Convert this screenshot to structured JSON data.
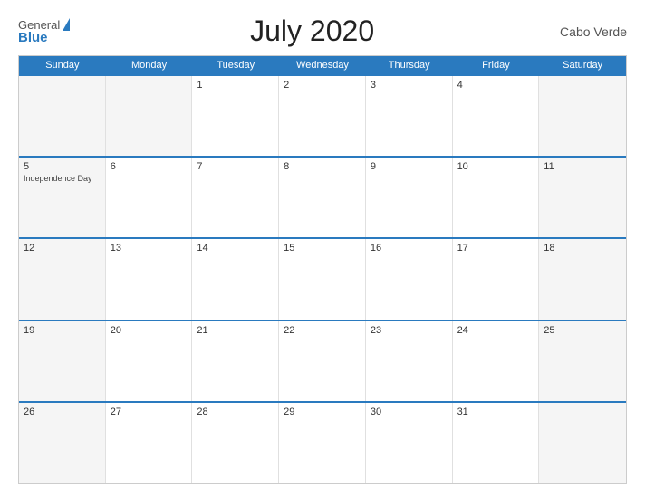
{
  "header": {
    "title": "July 2020",
    "country": "Cabo Verde",
    "logo_general": "General",
    "logo_blue": "Blue"
  },
  "calendar": {
    "days_of_week": [
      "Sunday",
      "Monday",
      "Tuesday",
      "Wednesday",
      "Thursday",
      "Friday",
      "Saturday"
    ],
    "weeks": [
      [
        {
          "day": "",
          "event": "",
          "empty": true
        },
        {
          "day": "",
          "event": "",
          "empty": true
        },
        {
          "day": "1",
          "event": "",
          "empty": false
        },
        {
          "day": "2",
          "event": "",
          "empty": false
        },
        {
          "day": "3",
          "event": "",
          "empty": false
        },
        {
          "day": "4",
          "event": "",
          "empty": false
        },
        {
          "day": "",
          "event": "",
          "empty": true
        }
      ],
      [
        {
          "day": "5",
          "event": "Independence Day",
          "empty": false
        },
        {
          "day": "6",
          "event": "",
          "empty": false
        },
        {
          "day": "7",
          "event": "",
          "empty": false
        },
        {
          "day": "8",
          "event": "",
          "empty": false
        },
        {
          "day": "9",
          "event": "",
          "empty": false
        },
        {
          "day": "10",
          "event": "",
          "empty": false
        },
        {
          "day": "11",
          "event": "",
          "empty": false
        }
      ],
      [
        {
          "day": "12",
          "event": "",
          "empty": false
        },
        {
          "day": "13",
          "event": "",
          "empty": false
        },
        {
          "day": "14",
          "event": "",
          "empty": false
        },
        {
          "day": "15",
          "event": "",
          "empty": false
        },
        {
          "day": "16",
          "event": "",
          "empty": false
        },
        {
          "day": "17",
          "event": "",
          "empty": false
        },
        {
          "day": "18",
          "event": "",
          "empty": false
        }
      ],
      [
        {
          "day": "19",
          "event": "",
          "empty": false
        },
        {
          "day": "20",
          "event": "",
          "empty": false
        },
        {
          "day": "21",
          "event": "",
          "empty": false
        },
        {
          "day": "22",
          "event": "",
          "empty": false
        },
        {
          "day": "23",
          "event": "",
          "empty": false
        },
        {
          "day": "24",
          "event": "",
          "empty": false
        },
        {
          "day": "25",
          "event": "",
          "empty": false
        }
      ],
      [
        {
          "day": "26",
          "event": "",
          "empty": false
        },
        {
          "day": "27",
          "event": "",
          "empty": false
        },
        {
          "day": "28",
          "event": "",
          "empty": false
        },
        {
          "day": "29",
          "event": "",
          "empty": false
        },
        {
          "day": "30",
          "event": "",
          "empty": false
        },
        {
          "day": "31",
          "event": "",
          "empty": false
        },
        {
          "day": "",
          "event": "",
          "empty": true
        }
      ]
    ]
  }
}
